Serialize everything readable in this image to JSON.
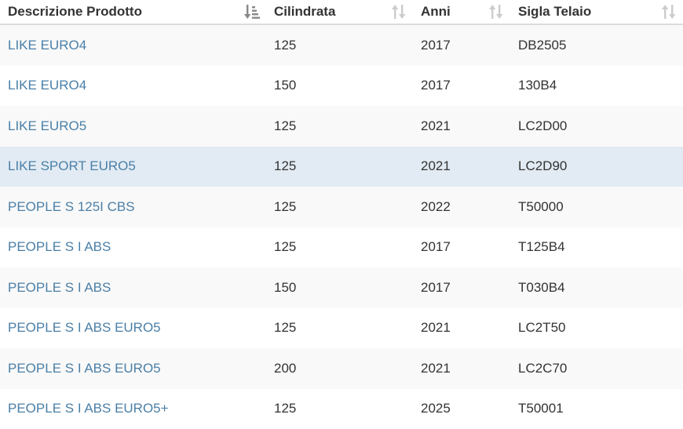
{
  "table": {
    "columns": [
      {
        "label": "Descrizione Prodotto",
        "sort_icon": "sort-amount-down-icon",
        "sorted": true
      },
      {
        "label": "Cilindrata",
        "sort_icon": "sort-updown-icon",
        "sorted": false
      },
      {
        "label": "Anni",
        "sort_icon": "sort-updown-icon",
        "sorted": false
      },
      {
        "label": "Sigla Telaio",
        "sort_icon": "sort-updown-icon",
        "sorted": false
      }
    ],
    "rows": [
      {
        "descrizione": "LIKE EURO4",
        "cilindrata": "125",
        "anni": "2017",
        "sigla": "DB2505"
      },
      {
        "descrizione": "LIKE EURO4",
        "cilindrata": "150",
        "anni": "2017",
        "sigla": "130B4"
      },
      {
        "descrizione": "LIKE EURO5",
        "cilindrata": "125",
        "anni": "2021",
        "sigla": "LC2D00"
      },
      {
        "descrizione": "LIKE SPORT EURO5",
        "cilindrata": "125",
        "anni": "2021",
        "sigla": "LC2D90"
      },
      {
        "descrizione": "PEOPLE S 125I CBS",
        "cilindrata": "125",
        "anni": "2022",
        "sigla": "T50000"
      },
      {
        "descrizione": "PEOPLE S I ABS",
        "cilindrata": "125",
        "anni": "2017",
        "sigla": "T125B4"
      },
      {
        "descrizione": "PEOPLE S I ABS",
        "cilindrata": "150",
        "anni": "2017",
        "sigla": "T030B4"
      },
      {
        "descrizione": "PEOPLE S I ABS EURO5",
        "cilindrata": "125",
        "anni": "2021",
        "sigla": "LC2T50"
      },
      {
        "descrizione": "PEOPLE S I ABS EURO5",
        "cilindrata": "200",
        "anni": "2021",
        "sigla": "LC2C70"
      },
      {
        "descrizione": "PEOPLE S I ABS EURO5+",
        "cilindrata": "125",
        "anni": "2025",
        "sigla": "T50001"
      }
    ],
    "highlighted_row_index": 3
  },
  "colors": {
    "link": "#4a7fa7",
    "row_odd": "#f9f9f9",
    "row_even": "#ffffff",
    "row_highlight": "#e2ebf3",
    "sort_icon_active": "#888888",
    "sort_icon_inactive": "#cccccc"
  }
}
